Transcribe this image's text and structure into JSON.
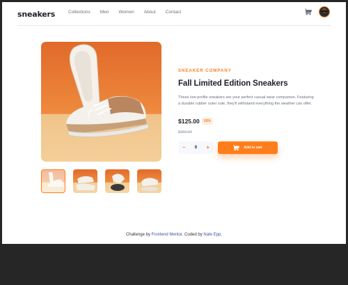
{
  "header": {
    "logo": "sneakers",
    "nav": [
      "Collections",
      "Men",
      "Women",
      "About",
      "Contact"
    ]
  },
  "product": {
    "company": "SNEAKER COMPANY",
    "title": "Fall Limited Edition Sneakers",
    "description": "These low-profile sneakers are your perfect casual wear companion. Featuring a durable rubber outer sole, they'll withstand everything the weather can offer.",
    "price": "$125.00",
    "discount": "50%",
    "old_price": "$250.00",
    "quantity": "0",
    "minus": "–",
    "plus": "+",
    "add_to_cart": "Add to cart"
  },
  "footer": {
    "prefix": "Challenge by ",
    "fm_link": "Frontend Mentor",
    "middle": ". Coded by ",
    "author_link": "Nate Epp",
    "suffix": "."
  },
  "colors": {
    "accent": "#ff7d1a",
    "dark": "#1d2026",
    "muted": "#69707d",
    "frame": "#262626"
  },
  "icons": [
    "cart-icon",
    "avatar",
    "cart-button-icon"
  ]
}
